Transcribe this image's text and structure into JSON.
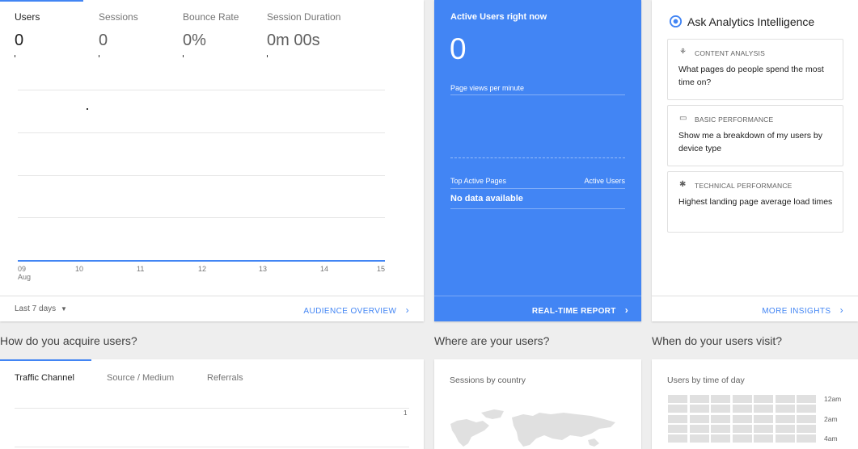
{
  "audience": {
    "metrics": [
      {
        "label": "Users",
        "value": "0"
      },
      {
        "label": "Sessions",
        "value": "0"
      },
      {
        "label": "Bounce Rate",
        "value": "0%"
      },
      {
        "label": "Session Duration",
        "value": "0m 00s"
      }
    ],
    "x_ticks": [
      "09",
      "10",
      "11",
      "12",
      "13",
      "14",
      "15"
    ],
    "x_month": "Aug",
    "range_label": "Last 7 days",
    "link": "AUDIENCE OVERVIEW"
  },
  "realtime": {
    "title": "Active Users right now",
    "count": "0",
    "pageviews_label": "Page views per minute",
    "col_pages": "Top Active Pages",
    "col_users": "Active Users",
    "no_data": "No data available",
    "link": "REAL-TIME REPORT",
    "bg_color": "#4285f4"
  },
  "insights": {
    "title": "Ask Analytics Intelligence",
    "cards": [
      {
        "category": "CONTENT ANALYSIS",
        "question": "What pages do people spend the most time on?",
        "icon": "content-icon"
      },
      {
        "category": "BASIC PERFORMANCE",
        "question": "Show me a breakdown of my users by device type",
        "icon": "device-icon"
      },
      {
        "category": "TECHNICAL PERFORMANCE",
        "question": "Highest landing page average load times",
        "icon": "bug-icon"
      }
    ],
    "link": "MORE INSIGHTS"
  },
  "sections": {
    "acquire": "How do you acquire users?",
    "where": "Where are your users?",
    "when": "When do your users visit?"
  },
  "acquisition": {
    "tabs": [
      "Traffic Channel",
      "Source / Medium",
      "Referrals"
    ],
    "y_tick": "1"
  },
  "geo": {
    "title": "Sessions by country"
  },
  "time": {
    "title": "Users by time of day",
    "hours": [
      "12am",
      "2am",
      "4am"
    ]
  },
  "accent": "#4285f4"
}
